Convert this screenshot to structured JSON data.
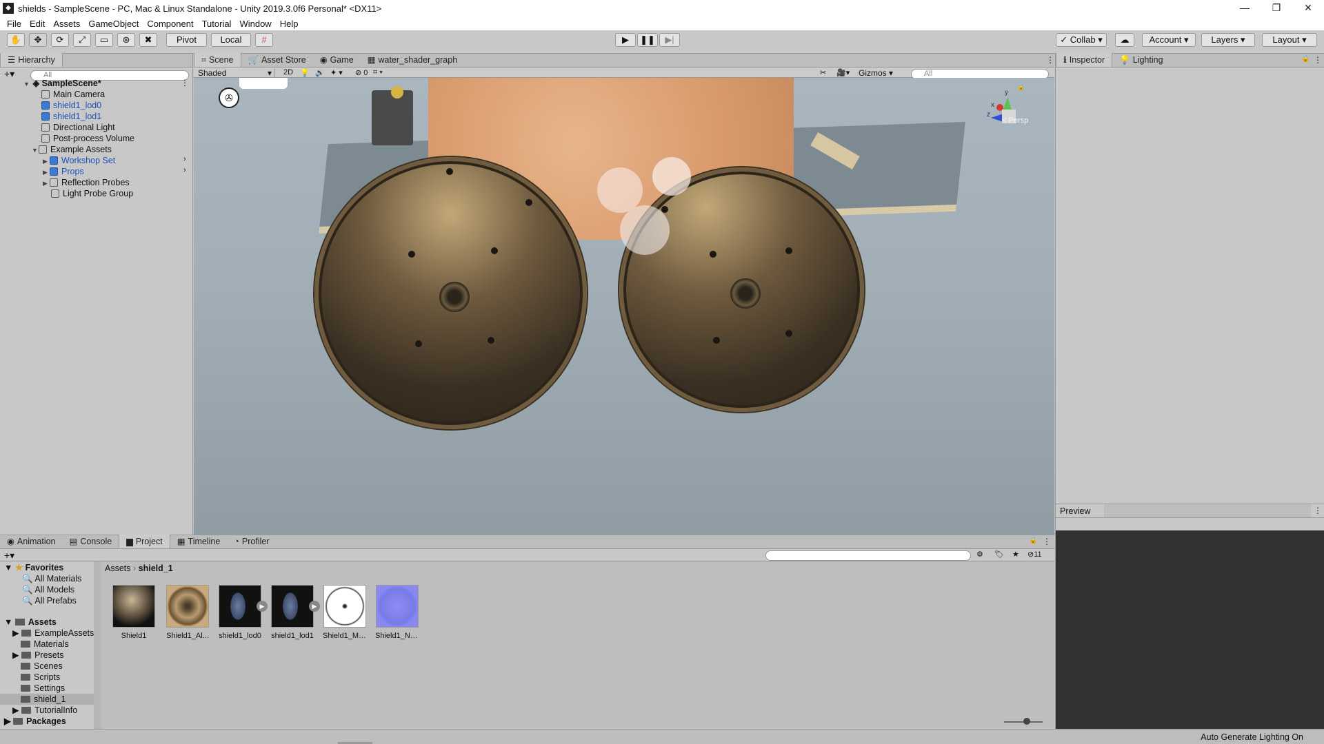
{
  "window": {
    "title": "shields - SampleScene - PC, Mac & Linux Standalone - Unity 2019.3.0f6 Personal* <DX11>"
  },
  "menu": [
    "File",
    "Edit",
    "Assets",
    "GameObject",
    "Component",
    "Tutorial",
    "Window",
    "Help"
  ],
  "toolbar": {
    "pivot": "Pivot",
    "local": "Local",
    "collab": "Collab",
    "account": "Account",
    "layers": "Layers",
    "layout": "Layout"
  },
  "hierarchy": {
    "tab": "Hierarchy",
    "search_placeholder": "All",
    "scene": "SampleScene*",
    "items": [
      {
        "label": "Main Camera"
      },
      {
        "label": "shield1_lod0"
      },
      {
        "label": "shield1_lod1"
      },
      {
        "label": "Directional Light"
      },
      {
        "label": "Post-process Volume"
      },
      {
        "label": "Example Assets"
      },
      {
        "label": "Workshop Set"
      },
      {
        "label": "Props"
      },
      {
        "label": "Reflection Probes"
      },
      {
        "label": "Light Probe Group"
      }
    ]
  },
  "scene_tabs": [
    "Scene",
    "Asset Store",
    "Game",
    "water_shader_graph"
  ],
  "scene_toolbar": {
    "shading": "Shaded",
    "mode2d": "2D",
    "hidden_count": "0",
    "gizmos": "Gizmos",
    "search_placeholder": "All"
  },
  "viewport": {
    "persp": "< Persp"
  },
  "inspector_tabs": [
    "Inspector",
    "Lighting"
  ],
  "preview": {
    "title": "Preview"
  },
  "bottom_tabs": [
    "Animation",
    "Console",
    "Project",
    "Timeline",
    "Profiler"
  ],
  "project": {
    "badge_count": "11",
    "breadcrumb": [
      "Assets",
      "shield_1"
    ],
    "favorites_title": "Favorites",
    "favorites": [
      "All Materials",
      "All Models",
      "All Prefabs"
    ],
    "assets_title": "Assets",
    "folders": [
      "ExampleAssets",
      "Materials",
      "Presets",
      "Scenes",
      "Scripts",
      "Settings",
      "shield_1",
      "TutorialInfo"
    ],
    "packages": "Packages",
    "assets": [
      {
        "label": "Shield1"
      },
      {
        "label": "Shield1_Al..."
      },
      {
        "label": "shield1_lod0"
      },
      {
        "label": "shield1_lod1"
      },
      {
        "label": "Shield1_Me..."
      },
      {
        "label": "Shield1_No..."
      }
    ]
  },
  "status": {
    "text": "Auto Generate Lighting On"
  }
}
